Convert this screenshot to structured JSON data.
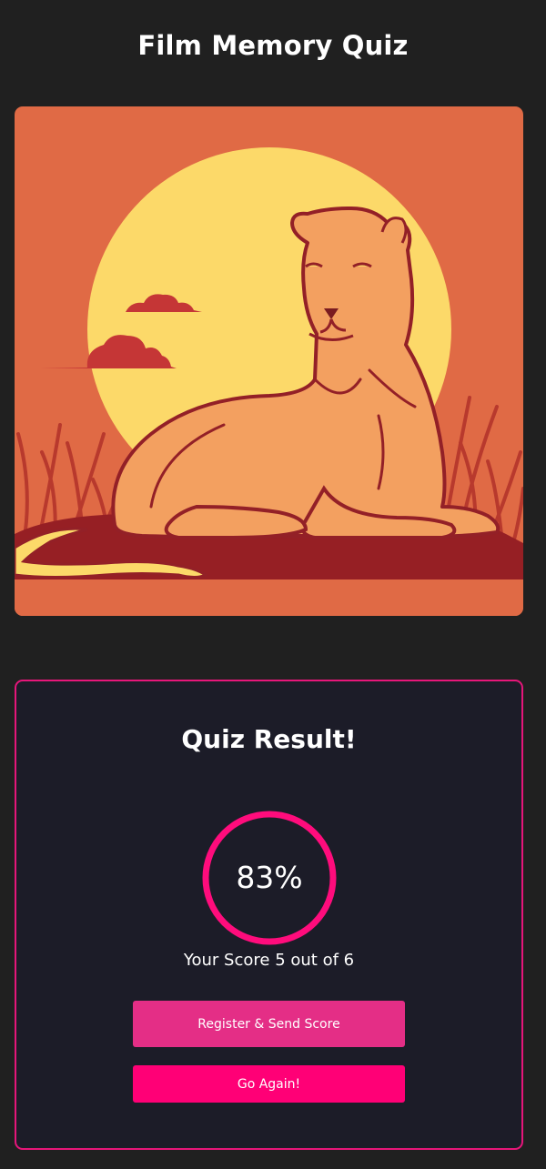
{
  "header": {
    "title": "Film Memory Quiz"
  },
  "illustration": {
    "icon": "lioness-sunset-illustration",
    "colors": {
      "background": "#e06a45",
      "sun": "#fcd969",
      "lioness": "#f3a060",
      "outline": "#932027",
      "ground": "#961f24"
    }
  },
  "result": {
    "title": "Quiz Result!",
    "percent_label": "83%",
    "percent": 83,
    "score_text": "Your Score 5 out of 6",
    "score": 5,
    "total": 6,
    "ring_color": "#ff0c7c"
  },
  "actions": {
    "register_label": "Register & Send Score",
    "again_label": "Go Again!"
  },
  "colors": {
    "page_background": "#202020",
    "card_background": "#1c1c28",
    "card_border": "#e6167a",
    "register_button": "#e42e86",
    "again_button": "#ff0076"
  }
}
